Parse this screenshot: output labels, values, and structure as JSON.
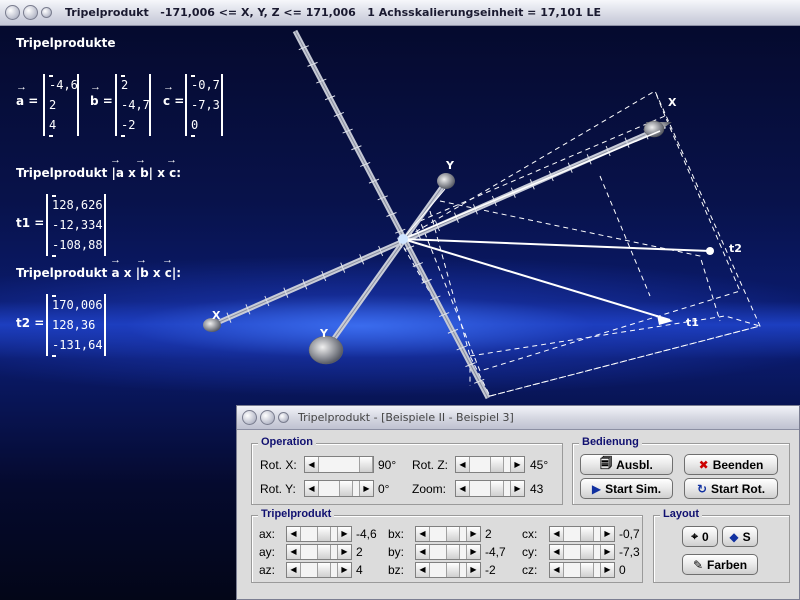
{
  "window": {
    "title": "Tripelprodukt   -171,006 <= X, Y, Z <= 171,006   1 Achsskalierungseinheit = 17,101 LE"
  },
  "math": {
    "heading": "Tripelprodukte",
    "vectors": [
      {
        "name": "a",
        "values": [
          "-4,6",
          "2",
          "4"
        ]
      },
      {
        "name": "b",
        "values": [
          "2",
          "-4,7",
          "-2"
        ]
      },
      {
        "name": "c",
        "values": [
          "-0,7",
          "-7,3",
          "0"
        ]
      }
    ],
    "t1_heading": "Tripelprodukt |a x b| x c:",
    "t1_name": "t1",
    "t1_values": [
      "128,626",
      "-12,334",
      "-108,88"
    ],
    "t2_heading": "Tripelprodukt a x |b x c|:",
    "t2_name": "t2",
    "t2_values": [
      "170,006",
      "128,36",
      "-131,64"
    ]
  },
  "scene": {
    "axis_labels": {
      "x_pos": "X",
      "x_neg": "X",
      "y_pos": "Y",
      "y_neg": "Y"
    },
    "point_labels": {
      "t1": "t1",
      "t2": "t2"
    }
  },
  "dialog": {
    "title": "Tripelprodukt - [Beispiele II - Beispiel 3]",
    "operation": {
      "label": "Operation",
      "rot_x_label": "Rot. X:",
      "rot_x_value": "90°",
      "rot_z_label": "Rot. Z:",
      "rot_z_value": "45°",
      "rot_y_label": "Rot. Y:",
      "rot_y_value": "0°",
      "zoom_label": "Zoom:",
      "zoom_value": "43"
    },
    "bedienung": {
      "label": "Bedienung",
      "ausbl": "Ausbl.",
      "beenden": "Beenden",
      "start_sim": "Start Sim.",
      "start_rot": "Start Rot."
    },
    "tripelprodukt": {
      "label": "Tripelprodukt",
      "rows": [
        [
          {
            "l": "ax:",
            "v": "-4,6"
          },
          {
            "l": "bx:",
            "v": "2"
          },
          {
            "l": "cx:",
            "v": "-0,7"
          }
        ],
        [
          {
            "l": "ay:",
            "v": "2"
          },
          {
            "l": "by:",
            "v": "-4,7"
          },
          {
            "l": "cy:",
            "v": "-7,3"
          }
        ],
        [
          {
            "l": "az:",
            "v": "4"
          },
          {
            "l": "bz:",
            "v": "-2"
          },
          {
            "l": "cz:",
            "v": "0"
          }
        ]
      ]
    },
    "layout": {
      "label": "Layout",
      "zero_btn": "0",
      "s_btn": "S",
      "farben_btn": "Farben"
    }
  }
}
